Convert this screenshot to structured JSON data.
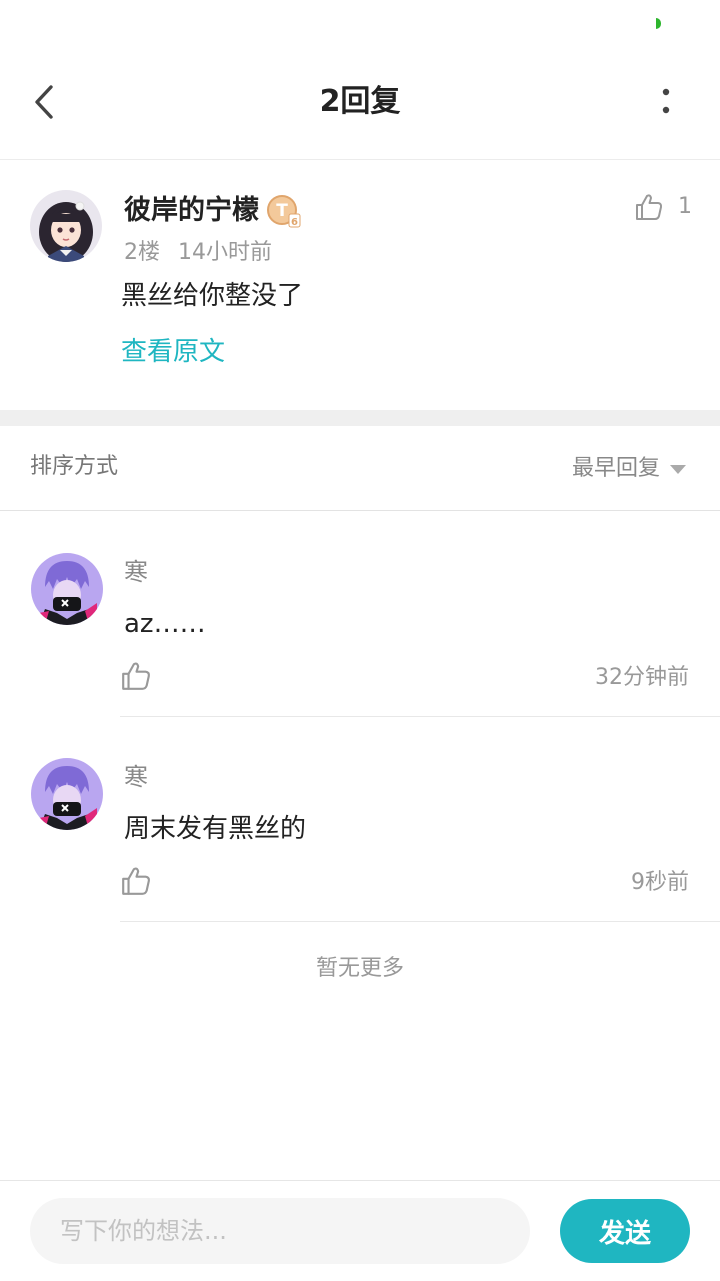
{
  "nav": {
    "title": "2回复"
  },
  "main_comment": {
    "author": "彼岸的宁檬",
    "badge_letter": "T",
    "badge_level": "6",
    "like_count": "1",
    "floor": "2楼",
    "time": "14小时前",
    "body": "黑丝给你整没了",
    "view_original": "查看原文"
  },
  "sort": {
    "label": "排序方式",
    "value": "最早回复"
  },
  "replies": [
    {
      "author": "寒",
      "text": "az……",
      "time": "32分钟前"
    },
    {
      "author": "寒",
      "text": "周末发有黑丝的",
      "time": "9秒前"
    }
  ],
  "list_footer": "暂无更多",
  "input": {
    "placeholder": "写下你的想法...",
    "send_label": "发送"
  },
  "colors": {
    "accent": "#1fb6c1",
    "status_dot": "#2db52d",
    "badge": "#e8b07a"
  }
}
